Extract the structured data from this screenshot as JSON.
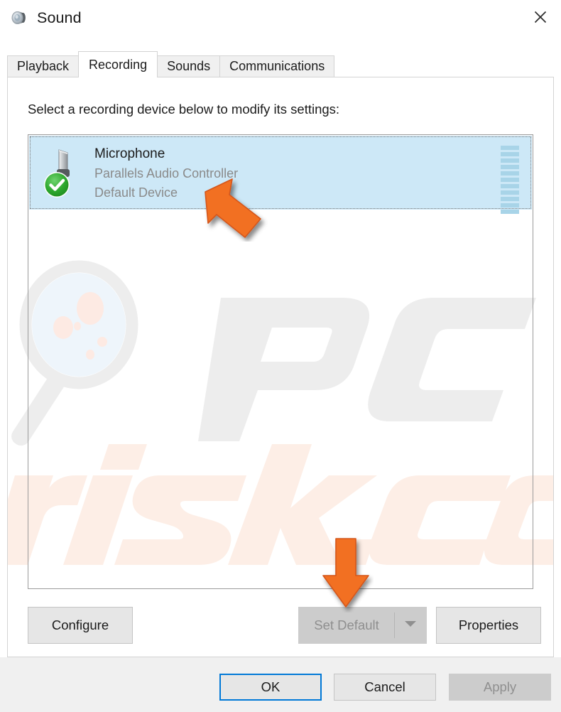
{
  "window": {
    "title": "Sound",
    "icon": "speaker-icon",
    "close_label": "✕"
  },
  "tabs": [
    {
      "label": "Playback",
      "active": false
    },
    {
      "label": "Recording",
      "active": true
    },
    {
      "label": "Sounds",
      "active": false
    },
    {
      "label": "Communications",
      "active": false
    }
  ],
  "panel": {
    "instruction": "Select a recording device below to modify its settings:"
  },
  "devices": [
    {
      "name": "Microphone",
      "driver": "Parallels Audio Controller",
      "status": "Default Device",
      "icon": "microphone-icon",
      "badge": "green-check-icon",
      "selected": true,
      "meter_segments": 11,
      "meter_active": 0
    }
  ],
  "mid_buttons": {
    "configure": "Configure",
    "set_default": "Set Default",
    "set_default_enabled": false,
    "set_default_dropdown": "chevron-down-icon",
    "properties": "Properties"
  },
  "footer_buttons": {
    "ok": "OK",
    "cancel": "Cancel",
    "apply": "Apply",
    "apply_enabled": false
  },
  "watermark": {
    "text_primary": "PC",
    "text_secondary": "risk.com"
  },
  "colors": {
    "accent": "#0078d7",
    "selection": "#cde8f7",
    "annotation_orange": "#f26f21",
    "disabled_text": "#8f8f8f",
    "subtext": "#8a8a8a"
  }
}
